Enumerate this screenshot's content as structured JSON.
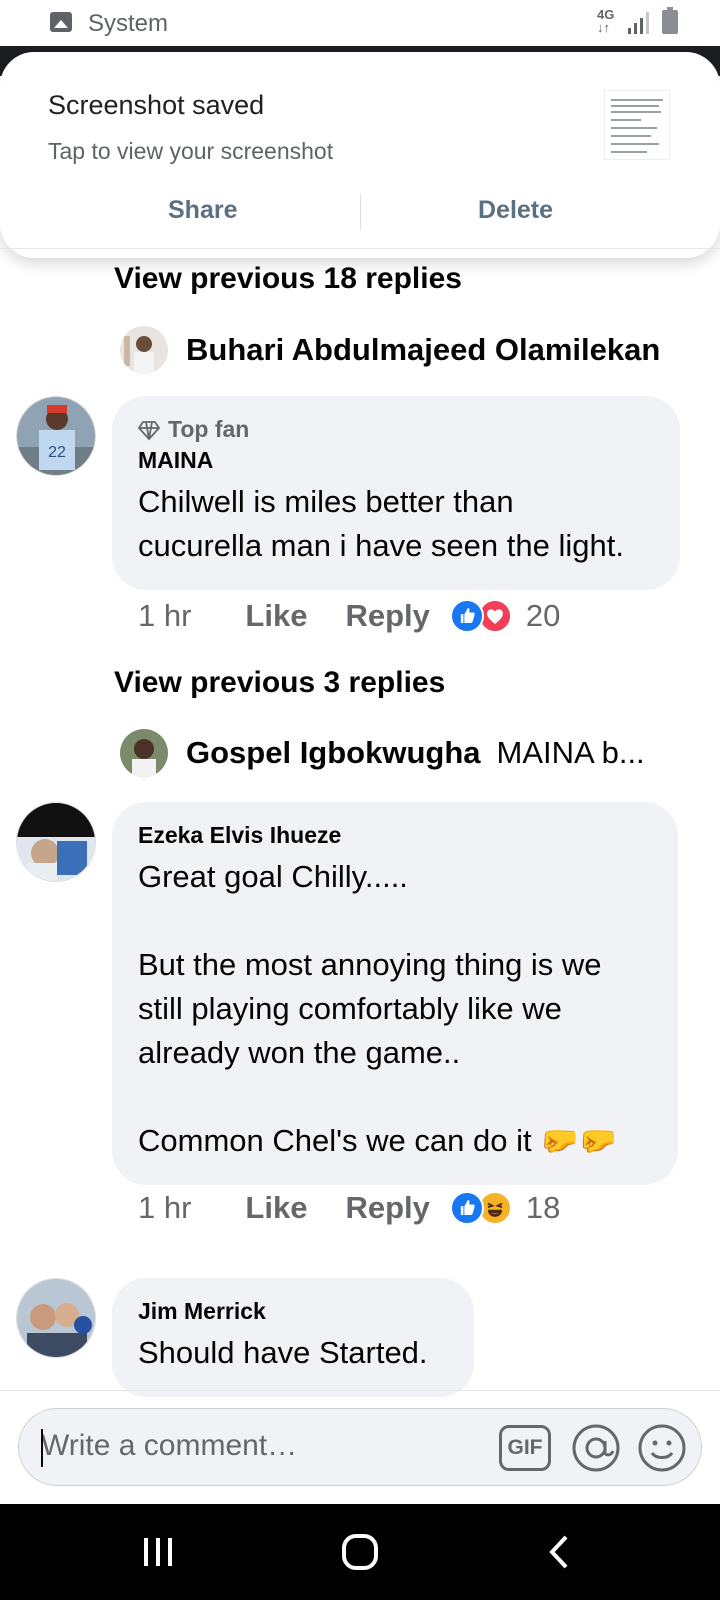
{
  "status_bar": {
    "app_label": "System",
    "network": "4G"
  },
  "toast": {
    "title": "Screenshot saved",
    "subtitle": "Tap to view your screenshot",
    "share_label": "Share",
    "delete_label": "Delete"
  },
  "thread": {
    "view_previous_1": "View previous 18 replies",
    "reply_preview_1": {
      "name": "Buhari Abdulmajeed Olamilekan",
      "text": ""
    },
    "comment_1": {
      "badge": "Top fan",
      "author": "MAINA",
      "text": "Chilwell is miles better than\ncucurella man i have seen the light.",
      "time": "1 hr",
      "like_label": "Like",
      "reply_label": "Reply",
      "reaction_count": "20",
      "reactions": [
        "like-icon",
        "love-icon"
      ]
    },
    "view_previous_2": "View previous 3 replies",
    "reply_preview_2": {
      "name": "Gospel Igbokwugha",
      "text": "MAINA b..."
    },
    "comment_2": {
      "author": "Ezeka Elvis Ihueze",
      "text": "Great goal Chilly.....\n\nBut the most annoying thing is we\nstill playing comfortably like we\nalready won the game..\n\nCommon Chel's we can do it 🤛🤛",
      "time": "1 hr",
      "like_label": "Like",
      "reply_label": "Reply",
      "reaction_count": "18",
      "reactions": [
        "like-icon",
        "haha-icon"
      ]
    },
    "comment_3": {
      "author": "Jim Merrick",
      "text": "Should have Started."
    }
  },
  "composer": {
    "placeholder": "Write a comment…",
    "gif_label": "GIF"
  },
  "colors": {
    "like_blue": "#1877f2",
    "love_red": "#f33e58",
    "haha_yellow": "#f7b125",
    "bubble_bg": "#f0f2f5",
    "secondary_text": "#65676b"
  }
}
